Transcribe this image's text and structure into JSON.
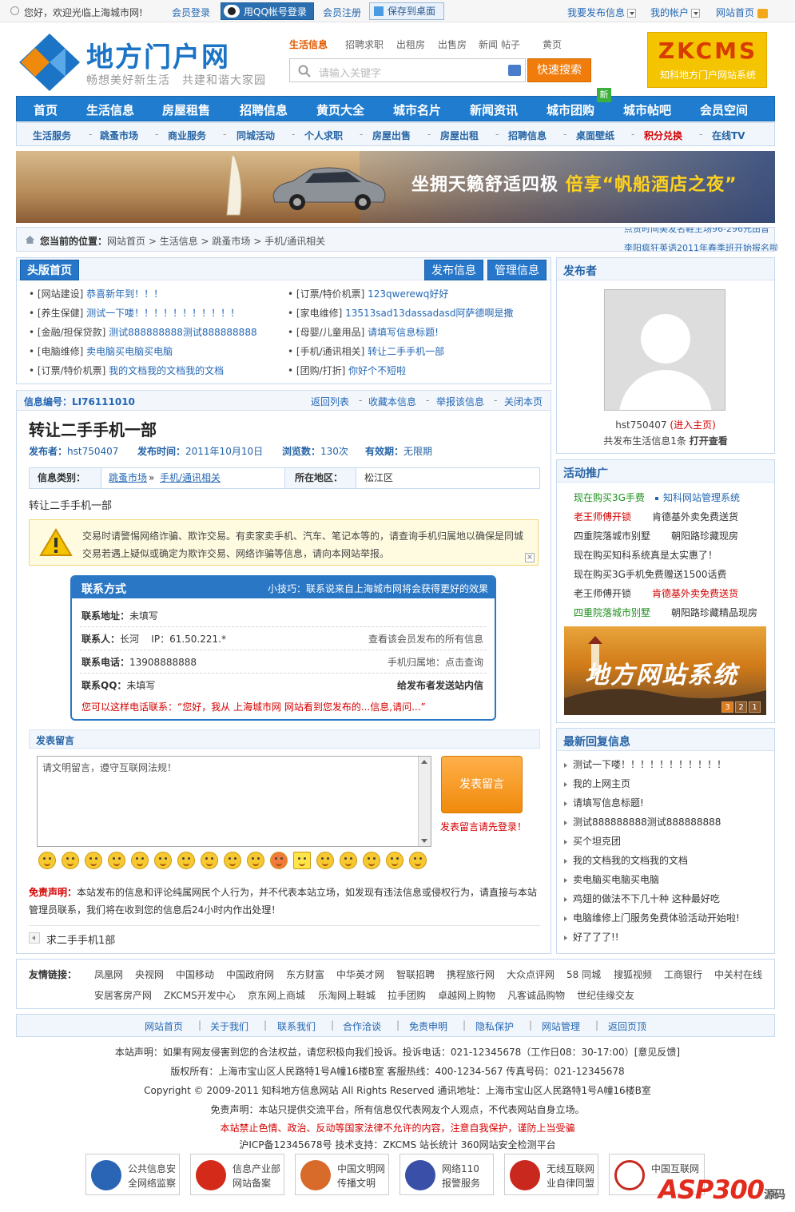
{
  "topbar": {
    "welcome": "您好，欢迎光临上海城市网!",
    "login": "会员登录",
    "qq_login": "用QQ帐号登录",
    "register": "会员注册",
    "save_desktop": "保存到桌面",
    "post_info": "我要发布信息",
    "my_account": "我的帐户",
    "site_home": "网站首页"
  },
  "header": {
    "logo_title": "地方门户网",
    "slogan": "畅想美好新生活　共建和谐大家园",
    "search_tabs": [
      "生活信息",
      "招聘求职",
      "出租房",
      "出售房",
      "新闻",
      "帖子",
      "黄页"
    ],
    "search_placeholder": "请输入关键字",
    "search_button": "快速搜索",
    "ad_title": "ZKCMS",
    "ad_sub": "知科地方门户网站系统"
  },
  "nav_main": [
    "首页",
    "生活信息",
    "房屋租售",
    "招聘信息",
    "黄页大全",
    "城市名片",
    "新闻资讯",
    "城市团购",
    "城市帖吧",
    "会员空间"
  ],
  "nav_new_tag": "新",
  "nav_sub": [
    "生活服务",
    "跳蚤市场",
    "商业服务",
    "同城活动",
    "个人求职",
    "房屋出售",
    "房屋出租",
    "招聘信息",
    "桌面壁纸",
    "积分兑换",
    "在线TV"
  ],
  "nav_sub_sep": "-",
  "banner": {
    "text_white": "坐拥天籁舒适四极",
    "text_gold": "倍享“帆船酒店之夜”"
  },
  "breadcrumb": {
    "label": "您当前的位置：",
    "path": "网站首页 > 生活信息 > 跳蚤市场 > 手机/通讯相关",
    "news1": "点赞时间美发名鞋主场96-296元由音",
    "news2": "李阳疯狂英语2011年春季班开始报名啦"
  },
  "headline": {
    "title": "头版首页",
    "btn_post": "发布信息",
    "btn_manage": "管理信息",
    "items": [
      {
        "cat": "[网站建设]",
        "text": "恭喜新年到！！！",
        "color": "#2467b4"
      },
      {
        "cat": "[订票/特价机票]",
        "text": "123qwerewq好好",
        "color": "#2467b4"
      },
      {
        "cat": "[养生保健]",
        "text": "测试一下喽！！！！！！！！！！！",
        "color": "#2467b4"
      },
      {
        "cat": "[家电维修]",
        "text": "13513sad13dassadasd阿萨德啊是撒",
        "color": "#2467b4"
      },
      {
        "cat": "[金融/担保贷款]",
        "text": "测试888888888测试888888888",
        "color": "#2467b4"
      },
      {
        "cat": "[母婴/儿童用品]",
        "text": "请填写信息标题!",
        "color": "#2467b4"
      },
      {
        "cat": "[电脑维修]",
        "text": "卖电脑买电脑买电脑",
        "color": "#2467b4"
      },
      {
        "cat": "[手机/通讯相关]",
        "text": "转让二手手机一部",
        "color": "#2467b4"
      },
      {
        "cat": "[订票/特价机票]",
        "text": "我的文档我的文档我的文档",
        "color": "#2467b4"
      },
      {
        "cat": "[团购/打折]",
        "text": "你好个不短啦",
        "color": "#2467b4"
      }
    ]
  },
  "infobar": {
    "id_label": "信息编号：LI76111010",
    "actions": [
      "返回列表",
      "收藏本信息",
      "举报该信息",
      "关闭本页"
    ],
    "sep": "-"
  },
  "detail": {
    "title": "转让二手手机一部",
    "publisher_label": "发布者：",
    "publisher": "hst750407",
    "time_label": "发布时间：",
    "time": "2011年10月10日",
    "views_label": "浏览数：",
    "views": "130次",
    "valid_label": "有效期：",
    "valid": "无限期",
    "cat_label": "信息类别：",
    "cat1": "跳蚤市场",
    "cat_sep": "»",
    "cat2": "手机/通讯相关",
    "area_label": "所在地区：",
    "area": "松江区",
    "content": "转让二手手机一部",
    "warning": "交易时请警惕网络诈骗、欺诈交易。有卖家卖手机、汽车、笔记本等的，请查询手机归属地以确保是同城交易若遇上疑似或确定为欺诈交易、网络诈骗等信息，请向本网站举报。"
  },
  "contact": {
    "title": "联系方式",
    "tip": "小技巧：联系说来自上海城市网将会获得更好的效果",
    "addr_label": "联系地址：",
    "addr": "未填写",
    "person_label": "联系人：",
    "person": "长河",
    "ip": "IP：61.50.221.*",
    "see_all": "查看该会员发布的所有信息",
    "phone_label": "联系电话：",
    "phone": "13908888888",
    "phone_loc": "手机归属地：点击查询",
    "qq_label": "联系QQ：",
    "qq": "未填写",
    "send_msg": "给发布者发送站内信",
    "call_script": "您可以这样电话联系：“您好，我从 上海城市网 网站看到您发布的...信息,请问...”"
  },
  "comment": {
    "title": "发表留言",
    "placeholder": "请文明留言，遵守互联网法规！",
    "button": "发表留言",
    "tip": "发表留言请先登录！",
    "disclaimer_label": "免责声明：",
    "disclaimer": "本站发布的信息和评论纯属网民个人行为，并不代表本站立场，如发现有违法信息或侵权行为，请直接与本站管理员联系，我们将在收到您的信息后24小时内作出处理！",
    "prev": "求二手手机1部"
  },
  "publisher_panel": {
    "title": "发布者",
    "name": "hst750407",
    "homepage": "(进入主页)",
    "count_text": "共发布生活信息1条",
    "view": "打开查看"
  },
  "promo": {
    "title": "活动推广",
    "items": [
      {
        "text": "现在购买3G手费",
        "cls": "g"
      },
      {
        "text": "知科网站管理系统",
        "cls": "b"
      },
      {
        "text": "老王师傅开锁",
        "cls": "r"
      },
      {
        "text": "肯德基外卖免费送货",
        "cls": ""
      },
      {
        "text": "四重院落城市别墅",
        "cls": ""
      },
      {
        "text": "朝阳路珍藏现房",
        "cls": ""
      },
      {
        "text": "现在购买知科系统真是太实惠了！",
        "cls": ""
      },
      {
        "text": "",
        "cls": ""
      },
      {
        "text": "现在购买3G手机免费赠送1500话费",
        "cls": ""
      },
      {
        "text": "",
        "cls": ""
      },
      {
        "text": "老王师傅开锁",
        "cls": ""
      },
      {
        "text": "肯德基外卖免费送货",
        "cls": "r"
      },
      {
        "text": "四重院落城市别墅",
        "cls": "g"
      },
      {
        "text": "朝阳路珍藏精品现房",
        "cls": ""
      }
    ],
    "ad_text": "地方网站系统",
    "pages": [
      "3",
      "2",
      "1"
    ]
  },
  "replies": {
    "title": "最新回复信息",
    "items": [
      "测试一下喽！！！！！！！！！！！",
      "我的上网主页",
      "请填写信息标题!",
      "测试888888888测试888888888",
      "买个坦克团",
      "我的文档我的文档我的文档",
      "卖电脑买电脑买电脑",
      "鸡翅的做法不下几十种 这种最好吃",
      "电脑维修上门服务免费体验活动开始啦!",
      "好了了了!!"
    ]
  },
  "friend_links": {
    "label": "友情链接：",
    "row1": [
      "凤凰网",
      "央视网",
      "中国移动",
      "中国政府网",
      "东方财富",
      "中华英才网",
      "智联招聘",
      "携程旅行网",
      "大众点评网",
      "58 同城",
      "搜狐视频",
      "工商银行",
      "中关村在线"
    ],
    "row2": [
      "安居客房产网",
      "ZKCMS开发中心",
      "京东网上商城",
      "乐淘网上鞋城",
      "拉手团购",
      "卓越网上购物",
      "凡客诚品购物",
      "世纪佳缘交友"
    ]
  },
  "footer_nav": [
    "网站首页",
    "关于我们",
    "联系我们",
    "合作洽谈",
    "免责申明",
    "隐私保护",
    "网站管理",
    "返回页顶"
  ],
  "footer_sep": "|",
  "footer": {
    "line1": "本站声明：如果有网友侵害到您的合法权益，请您积极向我们投诉。投诉电话：021-12345678（工作日08：30-17:00）[意见反馈]",
    "line2": "版权所有：上海市宝山区人民路特1号A幢16楼B室 客服热线：400-1234-567 传真号码：021-12345678",
    "line3": "Copyright © 2009-2011 知科地方信息网站 All Rights Reserved 通讯地址：上海市宝山区人民路特1号A幢16楼B室",
    "line4": "免责声明：本站只提供交流平台，所有信息仅代表网友个人观点，不代表网站自身立场。",
    "line5": "本站禁止色情、政治、反动等国家法律不允许的内容，注意自我保护，谨防上当受骗",
    "line6": "沪ICP备12345678号 技术支持：ZKCMS 站长统计 360网站安全检测平台"
  },
  "badges": [
    {
      "l1": "公共信息安",
      "l2": "全网络监察",
      "color": "#2a64b5"
    },
    {
      "l1": "信息产业部",
      "l2": "网站备案",
      "color": "#d42a1a"
    },
    {
      "l1": "中国文明网",
      "l2": "传播文明",
      "color": "#d86a2a"
    },
    {
      "l1": "网络110",
      "l2": "报警服务",
      "color": "#3a4fa8"
    },
    {
      "l1": "无线互联网",
      "l2": "业自律同盟",
      "color": "#c8281e"
    },
    {
      "l1": "中国互联网",
      "l2": "",
      "color": "#c8281e"
    }
  ],
  "watermark": {
    "main": "ASP300",
    "sub": "源码"
  }
}
